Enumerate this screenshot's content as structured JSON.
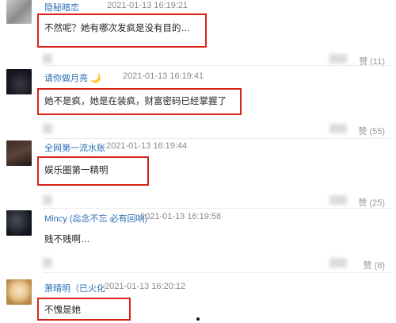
{
  "comments": [
    {
      "username": "隐秘暗恋",
      "timestamp": "2021-01-13 16:19:21",
      "content": "不然呢？她有哪次发疯是没有目的…",
      "likes": "赞 (11)"
    },
    {
      "username": "请你做月亮",
      "timestamp": "2021-01-13 16:19:41",
      "content": "她不是疯，她是在装疯，财富密码已经掌握了",
      "likes": "赞 (55)"
    },
    {
      "username": "全网第一流水账",
      "timestamp": "2021-01-13 16:19:44",
      "content": "娱乐圈第一精明",
      "likes": "赞 (25)"
    },
    {
      "username": "Mincy (惢念不忘 必有回响)",
      "timestamp": "2021-01-13 16:19:58",
      "content": "贱不贱啊…",
      "likes": "赞 (8)"
    },
    {
      "username": "萧晴明（已火化",
      "timestamp": "2021-01-13 16:20:12",
      "content": "不愧是她"
    }
  ],
  "icons": {
    "like": "thumbs-up-icon",
    "moon": "moon-icon"
  },
  "colors": {
    "username": "#2b6fb6",
    "highlight": "#d9231a",
    "timestamp": "#8a8a8a"
  }
}
